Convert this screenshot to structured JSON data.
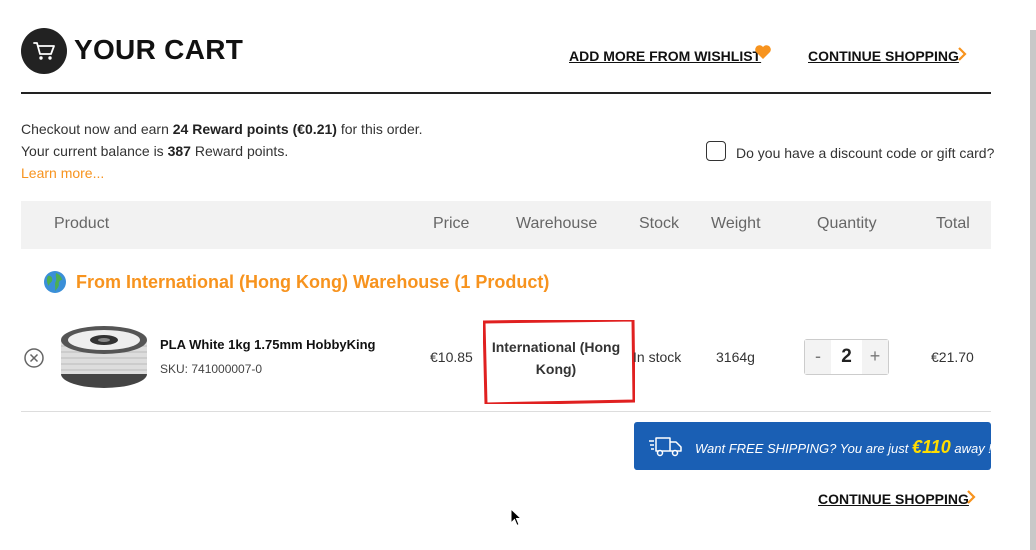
{
  "header": {
    "title": "YOUR CART",
    "wishlist_link": "ADD MORE FROM WISHLIST",
    "continue_shopping": "CONTINUE SHOPPING"
  },
  "rewards": {
    "line1_prefix": "Checkout now and earn ",
    "line1_points": "24 Reward points (€0.21)",
    "line1_suffix": " for this order.",
    "line2_prefix": "Your current balance is ",
    "line2_balance": "387",
    "line2_suffix": " Reward points.",
    "learn_more": "Learn more..."
  },
  "discount": {
    "label": "Do you have a discount code or gift card?",
    "checked": false
  },
  "table": {
    "columns": [
      "Product",
      "Price",
      "Warehouse",
      "Stock",
      "Weight",
      "Quantity",
      "Total"
    ]
  },
  "group": {
    "title": "From International (Hong Kong) Warehouse (1 Product)"
  },
  "items": [
    {
      "name": "PLA White 1kg 1.75mm HobbyKing",
      "sku": "SKU: 741000007-0",
      "price": "€10.85",
      "warehouse": "International (Hong Kong)",
      "stock": "In stock",
      "weight": "3164g",
      "quantity": "2",
      "total": "€21.70"
    }
  ],
  "shipping_banner": {
    "prefix": "Want FREE SHIPPING? You are just ",
    "amount": "€110",
    "suffix": " away !"
  },
  "footer": {
    "continue_shopping": "CONTINUE SHOPPING"
  },
  "colors": {
    "accent": "#f7931e",
    "banner": "#1a5fb4",
    "banner_amount": "#ffdd00",
    "annotation_box": "#e02020"
  },
  "icons": [
    "cart-icon",
    "heart-icon",
    "chevron-right-icon",
    "globe-icon",
    "remove-icon",
    "truck-icon",
    "mouse-cursor-icon"
  ]
}
